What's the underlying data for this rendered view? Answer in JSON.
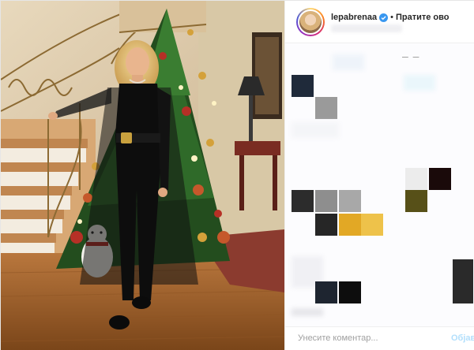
{
  "post": {
    "username": "lepabrenaa",
    "verified": true,
    "separator": "•",
    "follow_label": "Пратите ово",
    "comment_placeholder": "Унесите коментар...",
    "post_label": "Објави"
  },
  "icons": {
    "verified": "verified-badge-icon",
    "avatar": "profile-photo"
  },
  "colors": {
    "verified_blue": "#3897f0",
    "follow_text": "#262626",
    "post_button_disabled": "#b2dffc",
    "placeholder": "#a0a0a0"
  }
}
